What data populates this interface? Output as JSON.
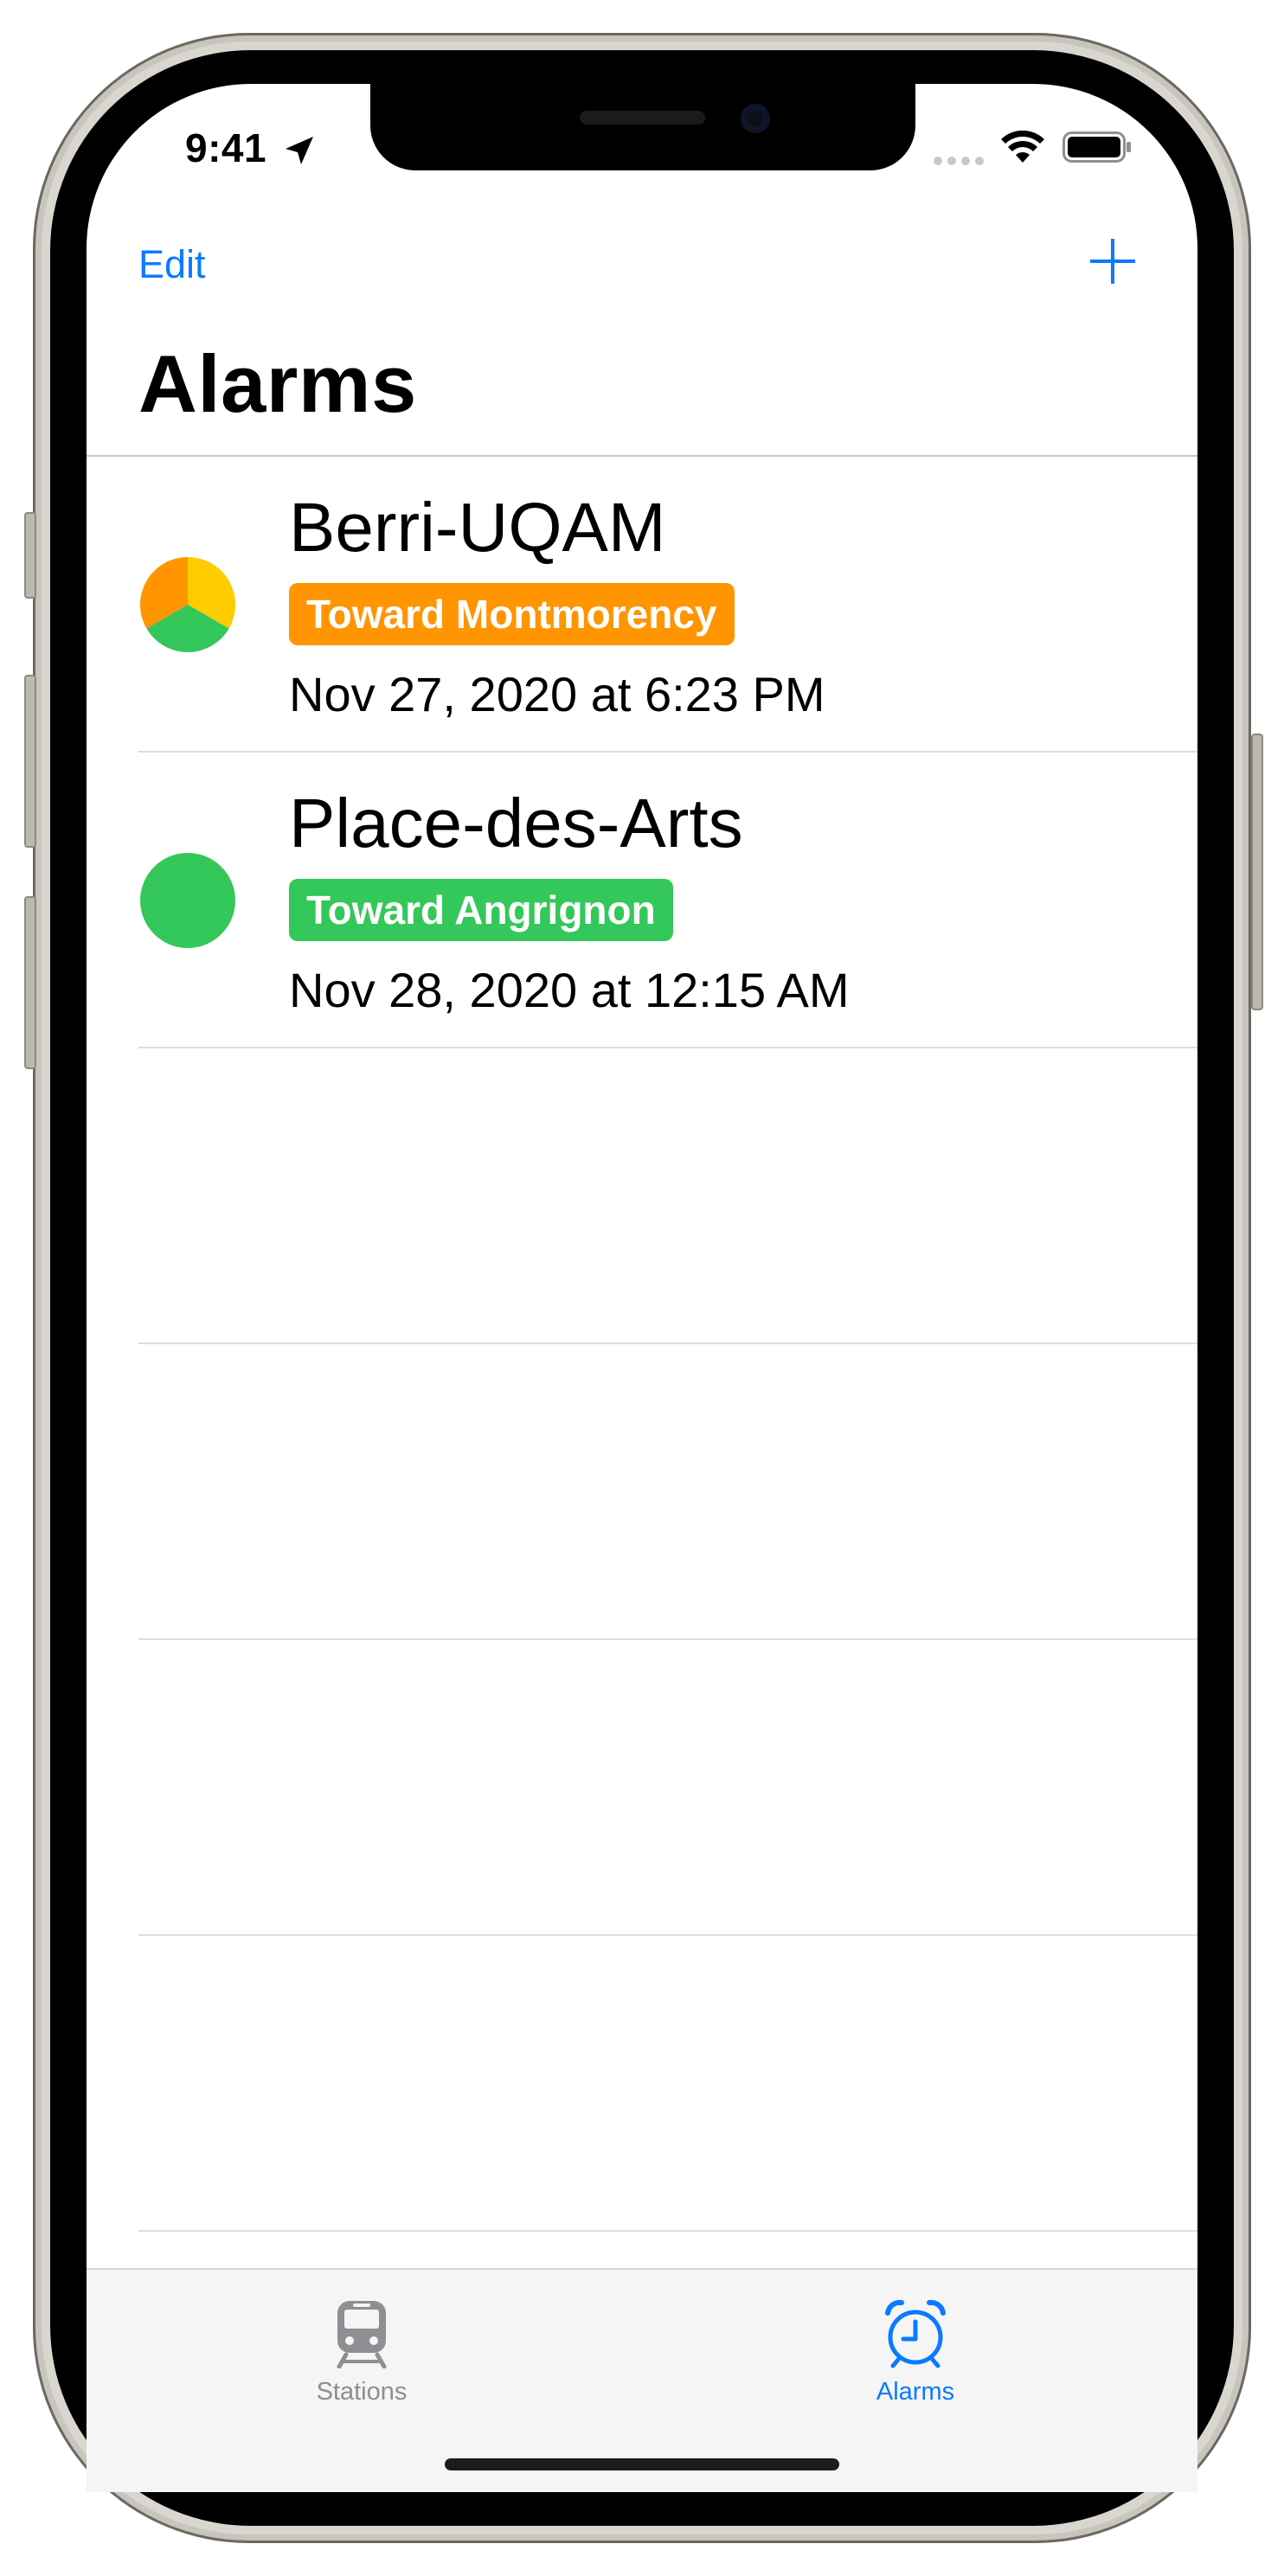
{
  "status_bar": {
    "time": "9:41"
  },
  "nav": {
    "edit_label": "Edit",
    "add_icon": "plus-icon",
    "title": "Alarms"
  },
  "alarms": [
    {
      "station": "Berri-UQAM",
      "direction": "Toward Montmorency",
      "direction_color": "#ff9500",
      "datetime": "Nov 27, 2020 at 6:23 PM",
      "line_colors": [
        "#ffcc00",
        "#34c759",
        "#ff9500"
      ]
    },
    {
      "station": "Place-des-Arts",
      "direction": "Toward Angrignon",
      "direction_color": "#34c759",
      "datetime": "Nov 28, 2020 at 12:15 AM",
      "line_colors": [
        "#34c759"
      ]
    }
  ],
  "tab_bar": {
    "tabs": [
      {
        "label": "Stations",
        "icon": "train-icon",
        "selected": false
      },
      {
        "label": "Alarms",
        "icon": "alarm-clock-icon",
        "selected": true
      }
    ]
  },
  "colors": {
    "accent": "#0a7aff",
    "inactive": "#8e8e93"
  }
}
